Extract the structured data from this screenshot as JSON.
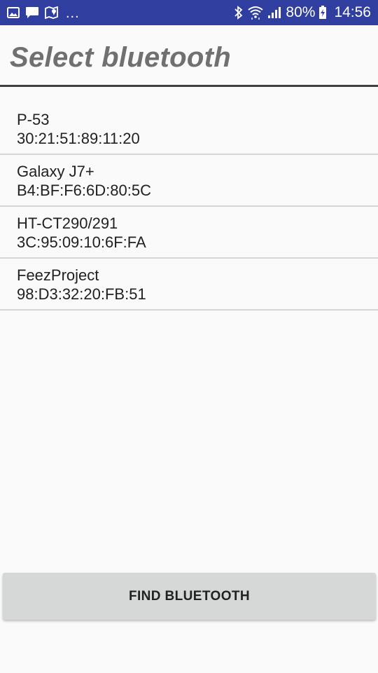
{
  "status_bar": {
    "left_icons": [
      "image-icon",
      "chat-icon",
      "map-pin-icon"
    ],
    "overflow": "...",
    "right_icons": [
      "bluetooth-icon",
      "wifi-icon",
      "signal-icon"
    ],
    "battery_percent": "80%",
    "battery_icon": "battery-charging-icon",
    "time": "14:56",
    "bar_color": "#303f9f"
  },
  "header": {
    "title": "Select bluetooth"
  },
  "devices": [
    {
      "name": "P-53",
      "address": "30:21:51:89:11:20"
    },
    {
      "name": "Galaxy J7+",
      "address": "B4:BF:F6:6D:80:5C"
    },
    {
      "name": "HT-CT290/291",
      "address": "3C:95:09:10:6F:FA"
    },
    {
      "name": "FeezProject",
      "address": "98:D3:32:20:FB:51"
    }
  ],
  "actions": {
    "find_label": "FIND BLUETOOTH"
  }
}
